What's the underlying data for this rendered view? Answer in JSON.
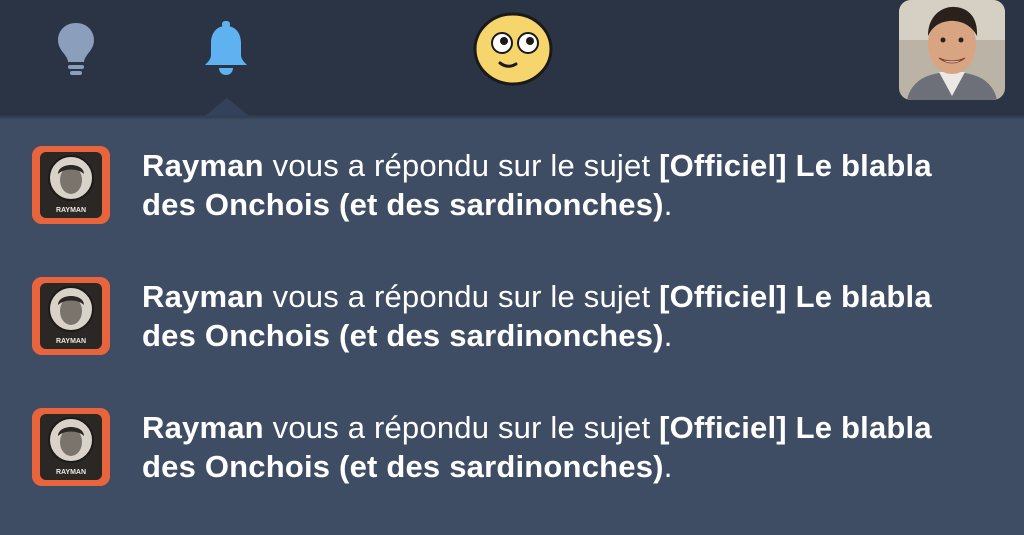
{
  "header": {
    "icons": {
      "bulb": "lightbulb-icon",
      "bell": "bell-icon",
      "emoji": "smiley-face-icon",
      "avatar": "user-avatar"
    },
    "colors": {
      "bar_bg": "#2b3445",
      "panel_bg": "#3e4d64",
      "bell_active": "#5fb2f0",
      "bulb_inactive": "#8b9fbd",
      "thumb_bg": "#e8643c"
    }
  },
  "notifications": [
    {
      "user": "Rayman",
      "action": " vous a répondu sur le sujet ",
      "topic": "[Officiel] Le blabla des Onchois (et des sardinonches)",
      "end": ".",
      "thumb_caption": "RAYMAN"
    },
    {
      "user": "Rayman",
      "action": " vous a répondu sur le sujet ",
      "topic": "[Officiel] Le blabla des Onchois (et des sardinonches)",
      "end": ".",
      "thumb_caption": "RAYMAN"
    },
    {
      "user": "Rayman",
      "action": " vous a répondu sur le sujet ",
      "topic": "[Officiel] Le blabla des Onchois (et des sardinonches)",
      "end": ".",
      "thumb_caption": "RAYMAN"
    }
  ]
}
